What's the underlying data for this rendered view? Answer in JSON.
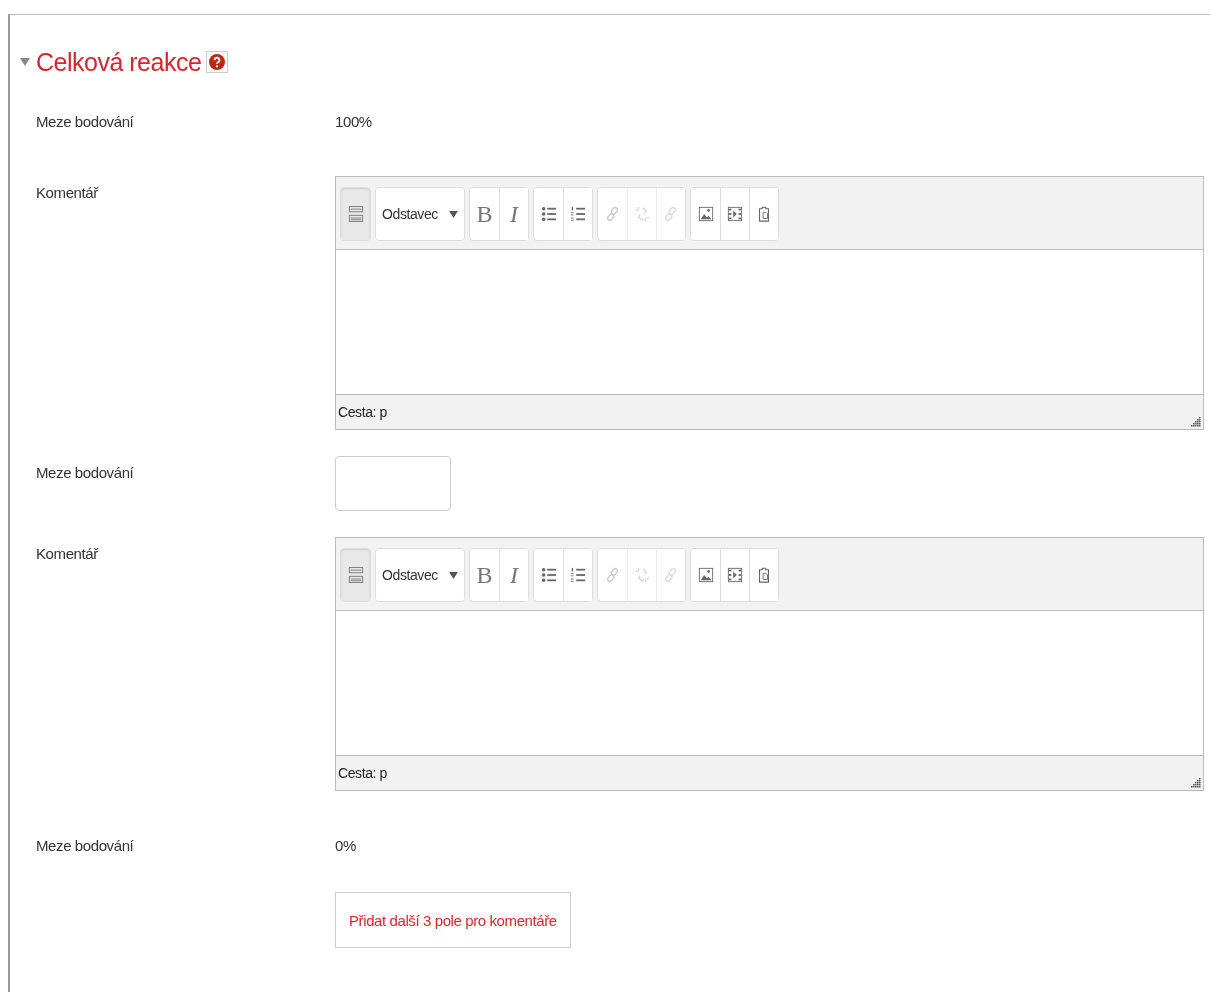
{
  "section": {
    "title": "Celková reakce",
    "expanded": true
  },
  "rows": [
    {
      "kind": "value",
      "label": "Meze bodování",
      "value": "100%"
    },
    {
      "kind": "editor",
      "label": "Komentář",
      "path": "Cesta: p",
      "toolbar": [
        [
          {
            "kind": "toggle",
            "disabled": false
          }
        ],
        [
          {
            "kind": "select",
            "value": "Odstavec",
            "disabled": false
          }
        ],
        [
          {
            "kind": "bold",
            "text": "B",
            "disabled": false
          },
          {
            "kind": "italic",
            "text": "I",
            "disabled": false
          }
        ],
        [
          {
            "kind": "bullets",
            "disabled": false
          },
          {
            "kind": "numbers",
            "disabled": false
          }
        ],
        [
          {
            "kind": "link",
            "disabled": true
          },
          {
            "kind": "unlink",
            "disabled": true
          },
          {
            "kind": "anchor",
            "disabled": true
          }
        ],
        [
          {
            "kind": "image",
            "disabled": false
          },
          {
            "kind": "media",
            "disabled": false
          },
          {
            "kind": "paste",
            "disabled": false
          }
        ]
      ]
    },
    {
      "kind": "input",
      "label": "Meze bodování"
    },
    {
      "kind": "editor",
      "label": "Komentář",
      "path": "Cesta: p",
      "toolbar": [
        [
          {
            "kind": "toggle",
            "disabled": false
          }
        ],
        [
          {
            "kind": "select",
            "value": "Odstavec",
            "disabled": false
          }
        ],
        [
          {
            "kind": "bold",
            "text": "B",
            "disabled": false
          },
          {
            "kind": "italic",
            "text": "I",
            "disabled": false
          }
        ],
        [
          {
            "kind": "bullets",
            "disabled": false
          },
          {
            "kind": "numbers",
            "disabled": false
          }
        ],
        [
          {
            "kind": "link",
            "disabled": true
          },
          {
            "kind": "unlink",
            "disabled": true
          },
          {
            "kind": "anchor",
            "disabled": true
          }
        ],
        [
          {
            "kind": "image",
            "disabled": false
          },
          {
            "kind": "media",
            "disabled": false
          },
          {
            "kind": "paste",
            "disabled": false
          }
        ]
      ]
    },
    {
      "kind": "value",
      "label": "Meze bodování",
      "value": "0%"
    }
  ],
  "add_button": "Přidat další 3 pole pro komentáře"
}
